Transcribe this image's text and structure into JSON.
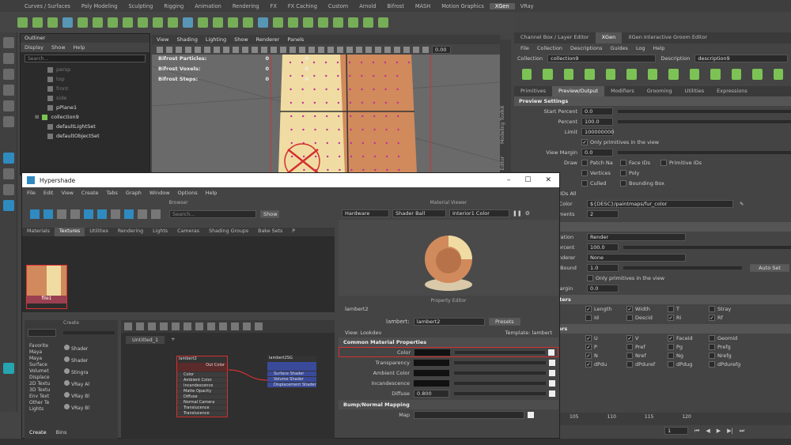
{
  "shelf_tabs": [
    "Curves / Surfaces",
    "Poly Modeling",
    "Sculpting",
    "Rigging",
    "Animation",
    "Rendering",
    "FX",
    "FX Caching",
    "Custom",
    "Arnold",
    "Bifrost",
    "MASH",
    "Motion Graphics",
    "XGen",
    "VRay"
  ],
  "shelf_active": "XGen",
  "outliner": {
    "title": "Outliner",
    "menu": [
      "Display",
      "Show",
      "Help"
    ],
    "search_placeholder": "Search...",
    "items": [
      "persp",
      "top",
      "front",
      "side",
      "pPlane1",
      "collection9",
      "defaultLightSet",
      "defaultObjectSet"
    ]
  },
  "viewport": {
    "menu": [
      "View",
      "Shading",
      "Lighting",
      "Show",
      "Renderer",
      "Panels"
    ],
    "zoom_value": "0.00",
    "hud": [
      {
        "key": "Bifrost Particles:",
        "v1": "0",
        "v2": "0"
      },
      {
        "key": "Bifrost Voxels:",
        "v1": "0",
        "v2": "0"
      },
      {
        "key": "Bifrost Steps:",
        "v1": "0",
        "v2": "0"
      }
    ]
  },
  "side_labels": [
    "Attribute Editor",
    "Modeling Toolkit"
  ],
  "right_panel": {
    "tabs": [
      "Channel Box / Layer Editor",
      "XGen",
      "XGen Interactive Groom Editor"
    ],
    "active_tab": "XGen",
    "menu": [
      "File",
      "Collection",
      "Descriptions",
      "Guides",
      "Log",
      "Help"
    ],
    "collection_label": "Collection",
    "collection_value": "collection9",
    "description_label": "Description",
    "description_value": "description9",
    "subtabs": [
      "Primitives",
      "Preview/Output",
      "Modifiers",
      "Grooming",
      "Utilities",
      "Expressions"
    ],
    "active_subtab": "Preview/Output",
    "preview_settings_title": "Preview Settings",
    "start_percent_label": "Start Percent",
    "start_percent_value": "0.0",
    "percent_label": "Percent",
    "percent_value": "100.0",
    "limit_label": "Limit",
    "limit_value": "100000000",
    "only_prims_label": "Only primitives in the view",
    "view_margin_label": "View Margin",
    "view_margin_value": "0.0",
    "draw_label": "Draw",
    "draw_opts": [
      {
        "label": "Patch Na",
        "checked": false
      },
      {
        "label": "Face IDs",
        "checked": false
      },
      {
        "label": "Primitive IDs",
        "checked": false
      },
      {
        "label": "Vertices",
        "checked": false
      },
      {
        "label": "Poly",
        "checked": false
      },
      {
        "label": "Culled",
        "checked": false
      },
      {
        "label": "Bounding Box",
        "checked": false
      }
    ],
    "ids_all_label": "e IDs All",
    "color_label": "r Color",
    "color_value": "${DESC}/paintmaps/fur_color",
    "segments_label": "gments",
    "segments_value": "2",
    "settings_title": "ings",
    "operation_label": "eration",
    "operation_value": "Render",
    "rpercent_label": "Percent",
    "rpercent_value": "100.0",
    "renderer_label": "enderer",
    "renderer_value": "None",
    "bound_label": "e Bound",
    "bound_value": "1.0",
    "auto_set_label": "Auto Set",
    "only_prims2_label": "Only primitives in the view",
    "margin_label": "Margin",
    "margin_value": "0.0",
    "shader_params_title": "hader Parameters",
    "shader_params": [
      {
        "label": "Length",
        "checked": true
      },
      {
        "label": "Width",
        "checked": true
      },
      {
        "label": "T",
        "checked": false
      },
      {
        "label": "Stray",
        "checked": false
      },
      {
        "label": "Id",
        "checked": false
      },
      {
        "label": "Descid",
        "checked": false
      },
      {
        "label": "Ri",
        "checked": true
      },
      {
        "label": "Rf",
        "checked": true
      }
    ],
    "loader_params_title": "ader Parameters",
    "loader_params": [
      {
        "label": "U",
        "checked": true
      },
      {
        "label": "V",
        "checked": true
      },
      {
        "label": "Faceid",
        "checked": true
      },
      {
        "label": "Geomid",
        "checked": false
      },
      {
        "label": "P",
        "checked": true
      },
      {
        "label": "Pref",
        "checked": false
      },
      {
        "label": "Pg",
        "checked": false
      },
      {
        "label": "Prefg",
        "checked": false
      },
      {
        "label": "N",
        "checked": true
      },
      {
        "label": "Nref",
        "checked": false
      },
      {
        "label": "Ng",
        "checked": false
      },
      {
        "label": "Nrefg",
        "checked": false
      },
      {
        "label": "dPdu",
        "checked": true
      },
      {
        "label": "dPduref",
        "checked": false
      },
      {
        "label": "dPdug",
        "checked": false
      },
      {
        "label": "dPdurefg",
        "checked": false
      }
    ]
  },
  "hypershade": {
    "title": "Hypershade",
    "menu": [
      "File",
      "Edit",
      "View",
      "Create",
      "Tabs",
      "Graph",
      "Window",
      "Options",
      "Help"
    ],
    "browser_title": "Browser",
    "search_placeholder": "Search...",
    "show_label": "Show",
    "browser_tabs": [
      "Materials",
      "Textures",
      "Utilities",
      "Rendering",
      "Lights",
      "Cameras",
      "Shading Groups",
      "Bake Sets",
      "P"
    ],
    "active_browser_tab": "Textures",
    "swatch_label": "file1",
    "material_viewer_title": "Material Viewer",
    "mv_renderer": "Hardware",
    "mv_shape": "Shader Ball",
    "mv_env": "Interior1 Color",
    "property_editor_title": "Property Editor",
    "pe_node": "lambert2",
    "pe_type_label": "lambert:",
    "pe_type_value": "lambert2",
    "presets_label": "Presets",
    "view_label": "View: Lookdev",
    "template_label": "Template: lambert",
    "common_section": "Common Material Properties",
    "props": [
      {
        "label": "Color",
        "value": ""
      },
      {
        "label": "Transparency",
        "value": ""
      },
      {
        "label": "Ambient Color",
        "value": ""
      },
      {
        "label": "Incandescence",
        "value": ""
      },
      {
        "label": "Diffuse",
        "value": "0.800"
      }
    ],
    "bump_section": "Bump/Normal Mapping",
    "map_label": "Map",
    "create_title": "Create",
    "create_tree": [
      "Favorite",
      "Maya",
      "Maya",
      "Surface",
      "Volumet",
      "Displace",
      "2D Textu",
      "3D Textu",
      "Env Text",
      "Other Te",
      "Lights"
    ],
    "create_items": [
      "Shader",
      "Shader",
      "Stingra",
      "VRay Al",
      "VRay Bl",
      "VRay Bl"
    ],
    "graph_tab": "Untitled_1",
    "graph_add": "+",
    "node1_name": "lambert2",
    "node1_out": "Out Color",
    "node1_attrs": [
      "Color",
      "Ambient Color",
      "Incandescence",
      "Matte Opacity",
      "Diffuse",
      "Normal Camera",
      "Translucence",
      "Translucence"
    ],
    "node2_name": "lambert2SG",
    "node2_attrs": [
      "Surface Shader",
      "Volume Shader",
      "Displacement Shader"
    ],
    "bottom_tabs": [
      "Create",
      "Bins"
    ]
  },
  "timeline": {
    "ticks": [
      "105",
      "110",
      "115",
      "120"
    ],
    "frame_value": "1"
  },
  "colors": {
    "accent_blue": "#2f8ac0",
    "xgen_green": "#7cc255",
    "highlight_red": "#d33030",
    "plane_orange": "#d18a5c",
    "plane_cream": "#f0dca2",
    "dot_magenta": "#c0309a"
  }
}
